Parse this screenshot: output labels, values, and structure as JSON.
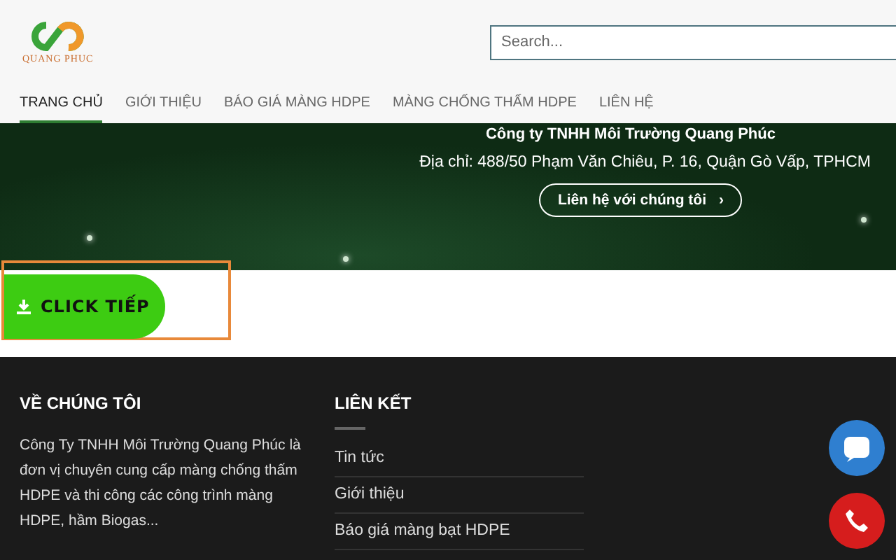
{
  "header": {
    "logo_text": "QUANG PHUC",
    "search": {
      "placeholder": "Search..."
    }
  },
  "nav": [
    {
      "label": "TRANG CHỦ",
      "selected": true
    },
    {
      "label": "GIỚI THIỆU",
      "selected": false
    },
    {
      "label": "BÁO GIÁ MÀNG HDPE",
      "selected": false
    },
    {
      "label": "MÀNG CHỐNG THẤM HDPE",
      "selected": false
    },
    {
      "label": "LIÊN HỆ",
      "selected": false
    }
  ],
  "hero": {
    "company": "Công ty TNHH Môi Trường Quang Phúc",
    "address": "Địa chỉ: 488/50 Phạm Văn Chiêu, P. 16, Quận Gò Vấp, TPHCM",
    "button": "Liên hệ với chúng tôi",
    "button_arrow": "›"
  },
  "download_button": "CLICK TIẾP",
  "footer": {
    "about_title": "VỀ CHÚNG TÔI",
    "about_text": "Công Ty TNHH Môi Trường Quang Phúc là đơn vị chuyên cung cấp màng chống thấm HDPE và thi công các công trình màng HDPE, hầm Biogas...",
    "links_title": "LIÊN KẾT",
    "links": [
      "Tin tức",
      "Giới thiệu",
      "Báo giá màng bạt HDPE"
    ]
  }
}
